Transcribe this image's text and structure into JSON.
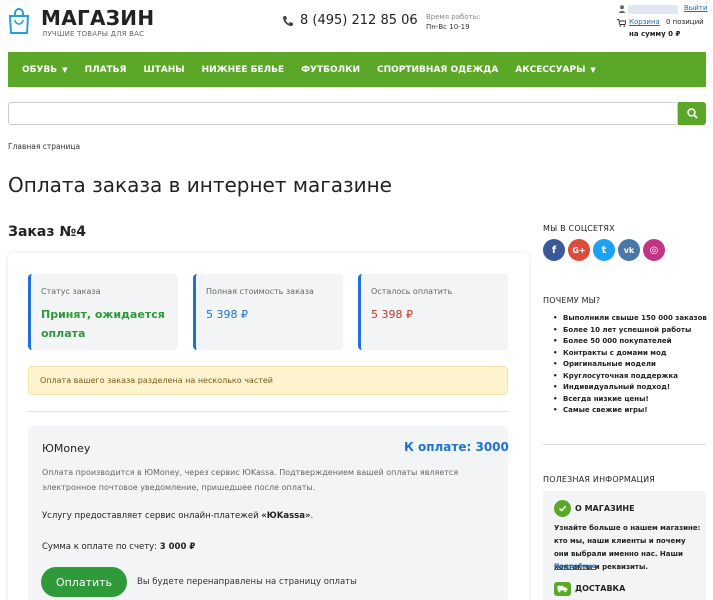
{
  "header": {
    "logo_title": "МАГАЗИН",
    "logo_subtitle": "ЛУЧШИЕ ТОВАРЫ ДЛЯ ВАС",
    "phone": "8 (495) 212 85 06",
    "hours_label": "Время работы:",
    "hours_value": "Пн-Вс 10-19",
    "logout_label": "Выйти",
    "cart_label": "Корзина",
    "cart_count": "0 позиций",
    "cart_sum": "на сумму 0 ₽"
  },
  "nav": {
    "items": [
      {
        "label": "ОБУВЬ",
        "dropdown": true
      },
      {
        "label": "ПЛАТЬЯ",
        "dropdown": false
      },
      {
        "label": "ШТАНЫ",
        "dropdown": false
      },
      {
        "label": "НИЖНЕЕ БЕЛЬЕ",
        "dropdown": false
      },
      {
        "label": "ФУТБОЛКИ",
        "dropdown": false
      },
      {
        "label": "СПОРТИВНАЯ ОДЕЖДА",
        "dropdown": false
      },
      {
        "label": "АКСЕССУАРЫ",
        "dropdown": true
      }
    ]
  },
  "search": {
    "placeholder": "",
    "value": ""
  },
  "breadcrumb": "Главная страница",
  "page_title": "Оплата заказа в интернет магазине",
  "order": {
    "title": "Заказ №4",
    "status_label": "Статус заказа",
    "status_value_line1": "Принят, ожидается",
    "status_value_line2": "оплата",
    "total_label": "Полная стоимость заказа",
    "total_value": "5 398 ₽",
    "remaining_label": "Осталось оплатить",
    "remaining_value": "5 398 ₽",
    "notice": "Оплата вашего заказа разделена на несколько частей"
  },
  "payment": {
    "name": "ЮMoney",
    "amount": "К оплате: 3000",
    "description": "Оплата производится в ЮMoney, через сервис ЮKassa. Подтверждением вашей оплаты является электронное почтовое уведомление, пришедшее после оплаты.",
    "service_prefix": "Услугу предоставляет сервис онлайн-платежей ",
    "service_name": "«ЮKassa»",
    "service_suffix": ".",
    "sum_prefix": "Сумма к оплате по счету: ",
    "sum_value": "3 000 ₽",
    "button_label": "Оплатить",
    "redirect_text": "Вы будете перенаправлены на страницу оплаты"
  },
  "sidebar": {
    "social_title": "МЫ В СОЦСЕТЯХ",
    "social": [
      {
        "icon": "facebook-icon",
        "glyph": "f",
        "color": "#3b5998"
      },
      {
        "icon": "google-plus-icon",
        "glyph": "G+",
        "color": "#dd4b39"
      },
      {
        "icon": "twitter-icon",
        "glyph": "t",
        "color": "#1da1f2"
      },
      {
        "icon": "vk-icon",
        "glyph": "vk",
        "color": "#4a76a8"
      },
      {
        "icon": "instagram-icon",
        "glyph": "◎",
        "color": "#c13584"
      }
    ],
    "why_title": "ПОЧЕМУ МЫ?",
    "why_items": [
      "Выполнили свыше 150 000 заказов",
      "Более 10 лет успешной работы",
      "Более 50 000 покупателей",
      "Контракты с домами мод",
      "Оригинальные модели",
      "Круглосуточная поддержка",
      "Индивидуальный подход!",
      "Всегда низкие цены!",
      "Самые свежие игры!"
    ],
    "info_title": "ПОЛЕЗНАЯ ИНФОРМАЦИЯ",
    "about_title": "О МАГАЗИНЕ",
    "about_text": "Узнайте больше о нашем магазине: кто мы, наши клиенты и почему они выбрали именно нас. Наши контакты и реквизиты.",
    "about_more": "Подробнее",
    "delivery_title": "ДОСТАВКА"
  },
  "colors": {
    "brand_green": "#5ba829",
    "accent_blue": "#1a73d9",
    "status_green": "#2e9a3a",
    "remaining_red": "#c0392b"
  }
}
